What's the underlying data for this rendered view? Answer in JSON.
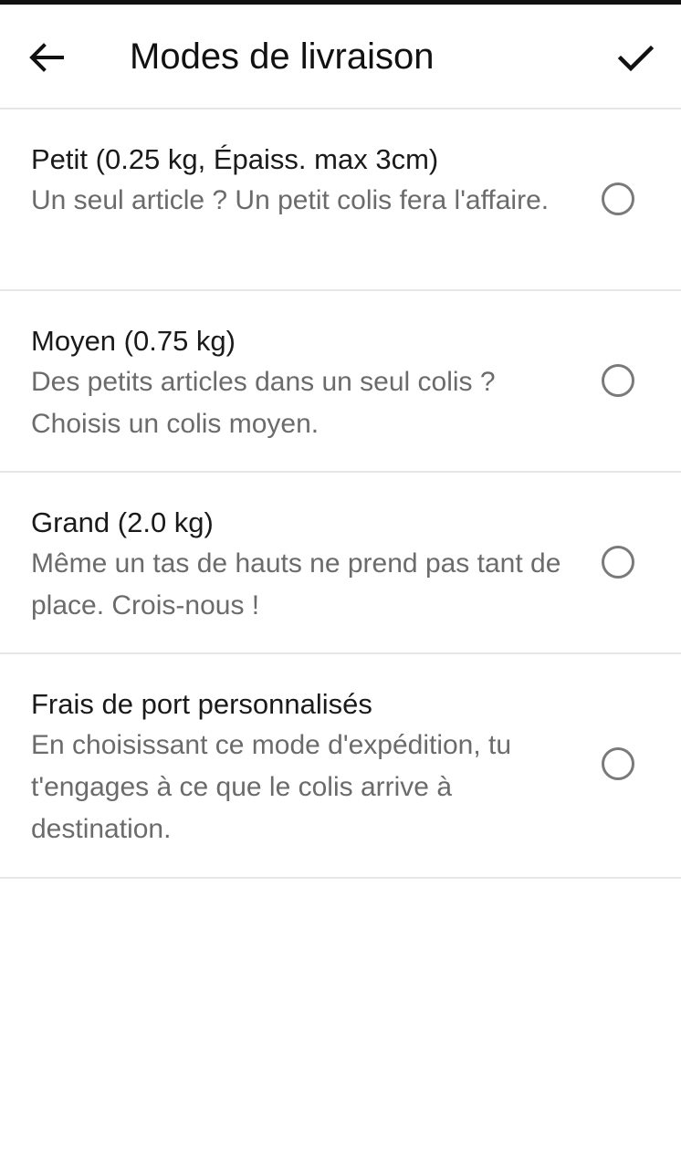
{
  "header": {
    "title": "Modes de livraison",
    "back_icon": "arrow-left-icon",
    "confirm_icon": "check-icon"
  },
  "options": [
    {
      "title": "Petit (0.25 kg, Épaiss. max 3cm)",
      "description": "Un seul article ? Un petit colis fera l'affaire.",
      "selected": false
    },
    {
      "title": "Moyen (0.75 kg)",
      "description": "Des petits articles dans un seul colis ? Choisis un colis moyen.",
      "selected": false
    },
    {
      "title": "Grand (2.0 kg)",
      "description": "Même un tas de hauts ne prend pas tant de place. Crois-nous !",
      "selected": false
    },
    {
      "title": "Frais de port personnalisés",
      "description": "En choisissant ce mode d'expédition, tu t'engages à ce que le colis arrive à destination.",
      "selected": false
    }
  ],
  "colors": {
    "text_primary": "#1a1a1a",
    "text_secondary": "#6b6b6b",
    "divider": "#e6e6e6",
    "radio_border": "#7a7a7a"
  }
}
